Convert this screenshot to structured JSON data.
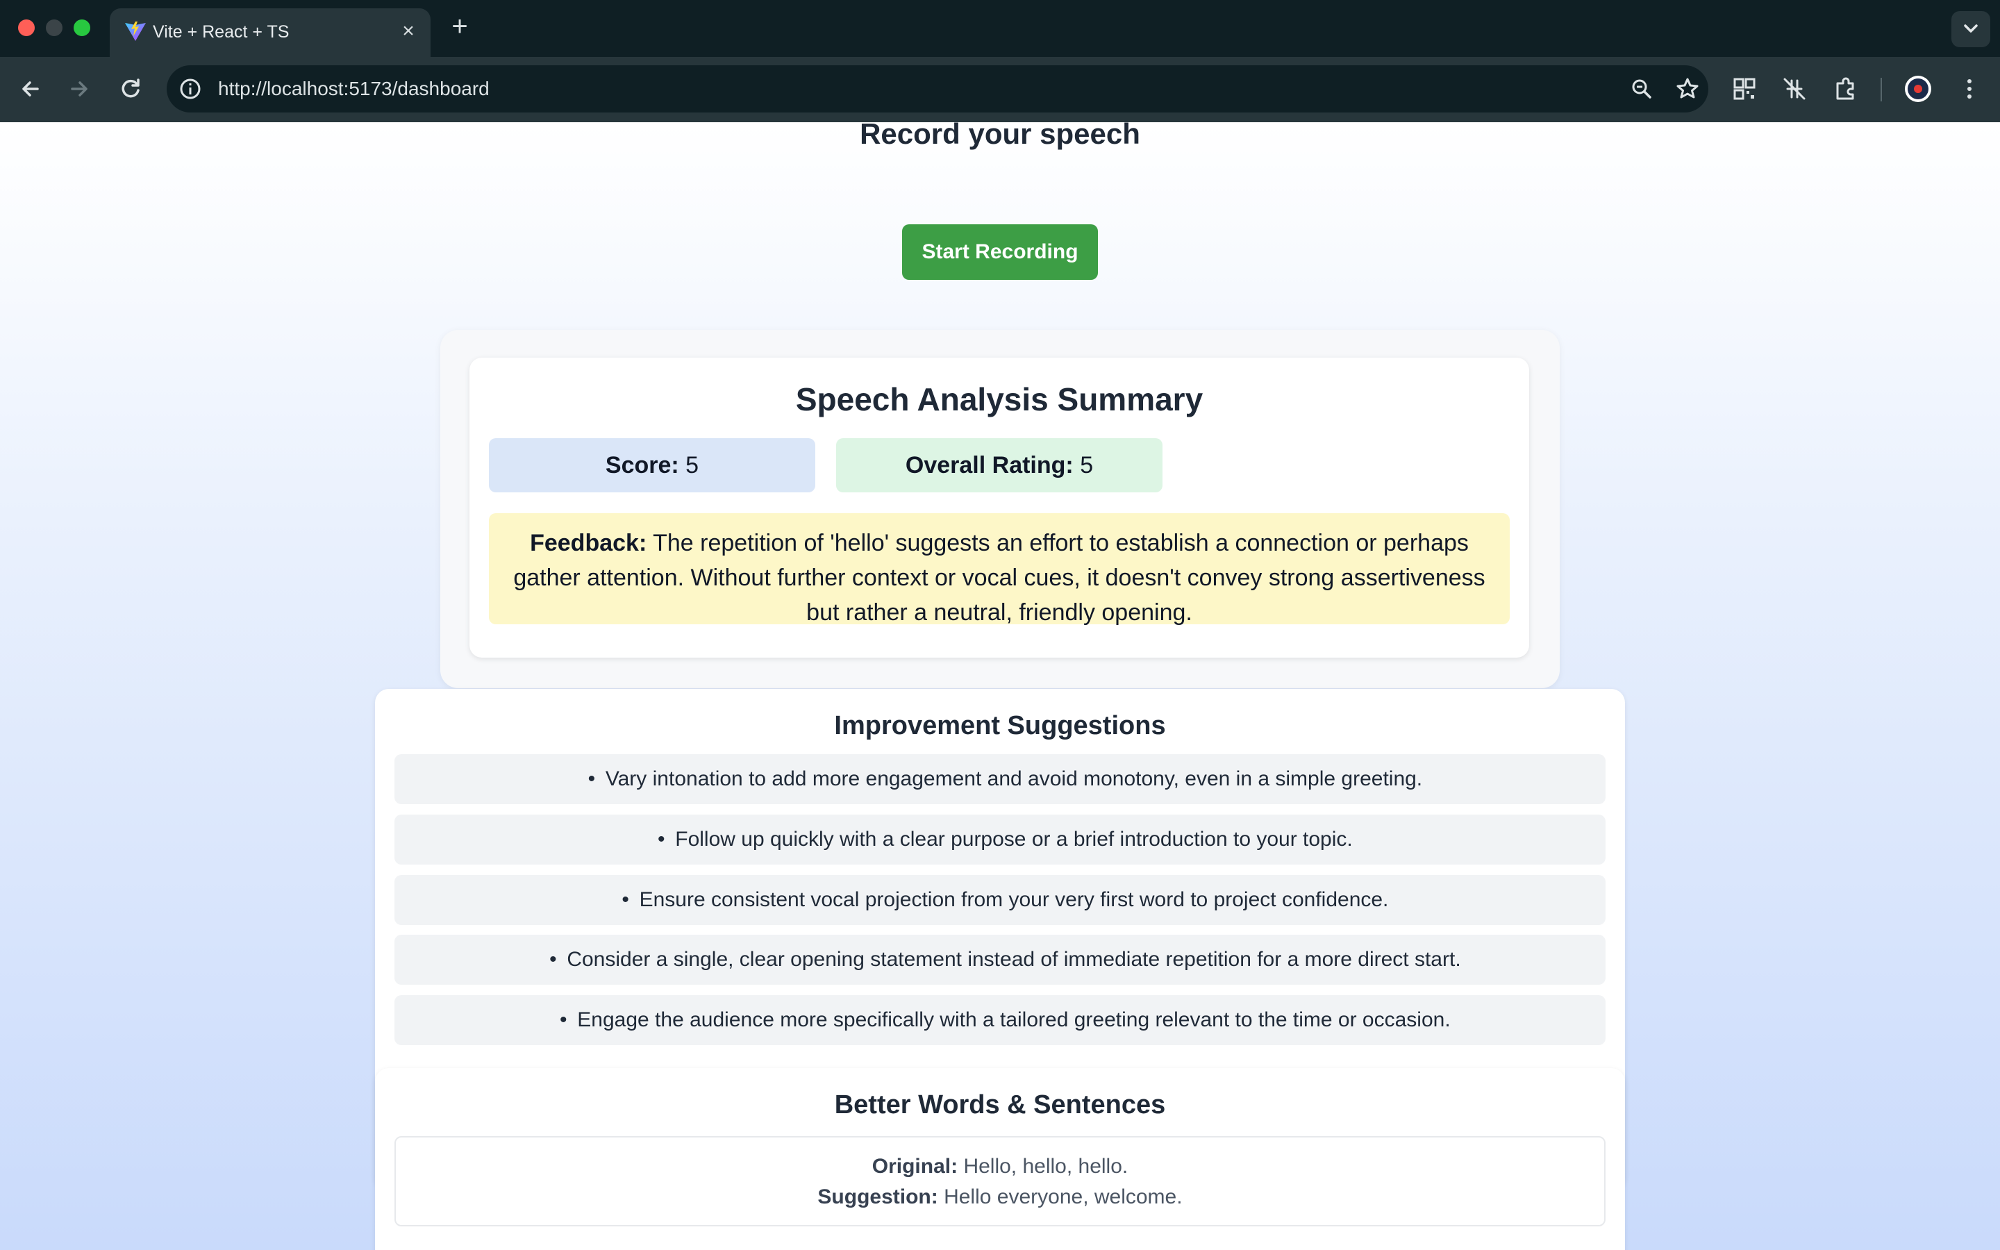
{
  "browser": {
    "tab_title": "Vite + React + TS",
    "new_tab_symbol": "+",
    "close_symbol": "×",
    "url": "http://localhost:5173/dashboard"
  },
  "page": {
    "heading": "Record your speech",
    "record_button": "Start Recording"
  },
  "summary": {
    "title": "Speech Analysis Summary",
    "score_label": "Score:",
    "score_value": "5",
    "rating_label": "Overall Rating:",
    "rating_value": "5",
    "feedback_label": "Feedback:",
    "feedback_text": "The repetition of 'hello' suggests an effort to establish a connection or perhaps gather attention. Without further context or vocal cues, it doesn't convey strong assertiveness but rather a neutral, friendly opening."
  },
  "suggestions": {
    "title": "Improvement Suggestions",
    "items": [
      "Vary intonation to add more engagement and avoid monotony, even in a simple greeting.",
      "Follow up quickly with a clear purpose or a brief introduction to your topic.",
      "Ensure consistent vocal projection from your very first word to project confidence.",
      "Consider a single, clear opening statement instead of immediate repetition for a more direct start.",
      "Engage the audience more specifically with a tailored greeting relevant to the time or occasion."
    ]
  },
  "better": {
    "title": "Better Words & Sentences",
    "original_label": "Original:",
    "original_text": "Hello, hello, hello.",
    "suggestion_label": "Suggestion:",
    "suggestion_text": "Hello everyone, welcome."
  },
  "colors": {
    "record_button": "#3d9e45",
    "score_bg": "#dae6f8",
    "rating_bg": "#ddf5e4",
    "feedback_bg": "#fdf7c8"
  }
}
